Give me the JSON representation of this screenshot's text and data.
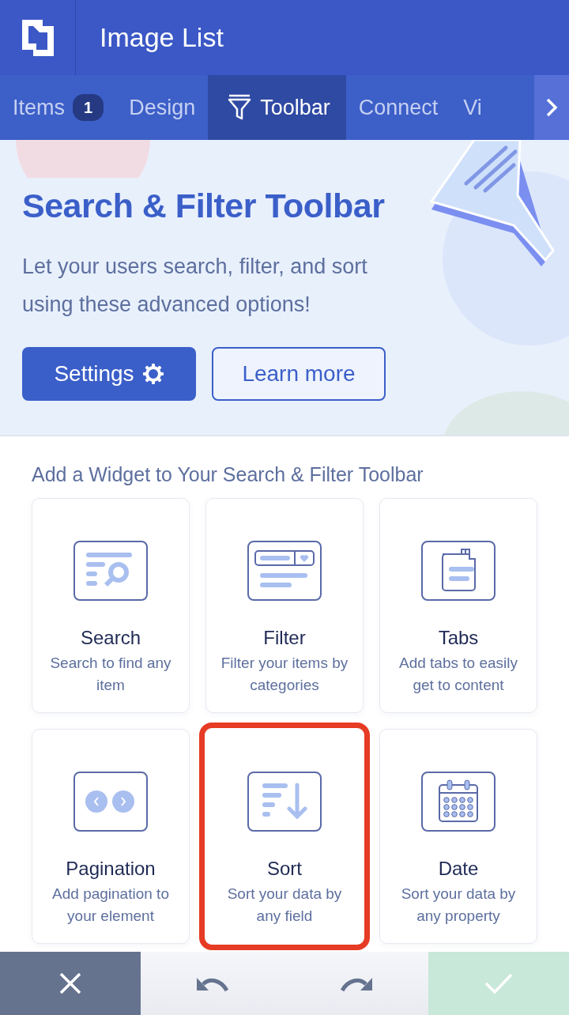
{
  "header": {
    "title": "Image List"
  },
  "tabs": [
    {
      "kind": "badge",
      "label": "Items",
      "badge": "1",
      "selected": false
    },
    {
      "kind": "plain",
      "label": "Design",
      "selected": false
    },
    {
      "kind": "icon",
      "label": "Toolbar",
      "selected": true
    },
    {
      "kind": "plain",
      "label": "Connect",
      "selected": false
    },
    {
      "kind": "plain",
      "label": "Vi",
      "selected": false
    }
  ],
  "hero": {
    "title": "Search & Filter Toolbar",
    "text": "Let your users search, filter, and sort using these advanced options!",
    "buttons": [
      {
        "label": "Settings",
        "kind": "primary"
      },
      {
        "label": "Learn more",
        "kind": "outline"
      }
    ]
  },
  "section_title": "Add a Widget to Your Search & Filter Toolbar",
  "widgets": [
    {
      "kind": "search",
      "title": "Search",
      "text": "Search to find any item",
      "selected": false
    },
    {
      "kind": "filter",
      "title": "Filter",
      "text": "Filter your items by categories",
      "selected": false
    },
    {
      "kind": "tabs",
      "title": "Tabs",
      "text": "Add tabs to easily get to content",
      "selected": false
    },
    {
      "kind": "pagination",
      "title": "Pagination",
      "text": "Add pagination to your element",
      "selected": false
    },
    {
      "kind": "sort",
      "title": "Sort",
      "text": "Sort your data by any field",
      "selected": true
    },
    {
      "kind": "date",
      "title": "Date",
      "text": "Sort your data by any property",
      "selected": false
    }
  ],
  "footer": {
    "confirm_disabled": true
  }
}
